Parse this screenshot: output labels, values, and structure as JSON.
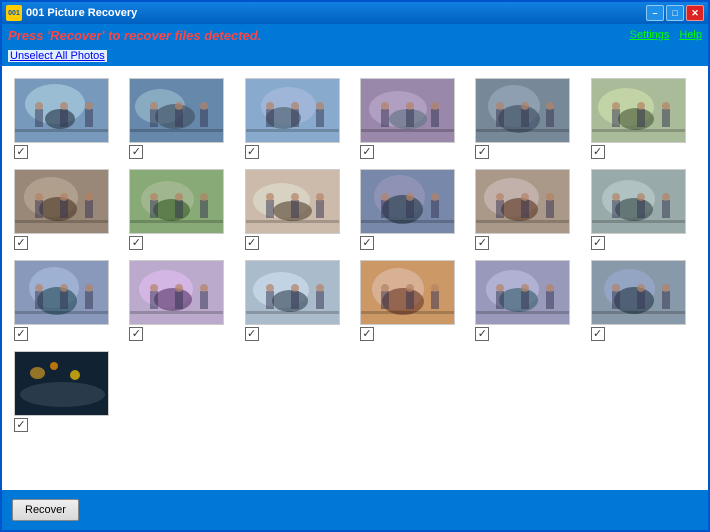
{
  "window": {
    "title": "001 Picture Recovery",
    "title_icon": "001"
  },
  "header": {
    "instruction": "Press 'Recover' to recover files detected.",
    "unselect_all": "Unselect All Photos",
    "settings_link": "Settings",
    "help_link": "Help"
  },
  "photos": {
    "count": 19,
    "all_checked": true,
    "items": [
      {
        "id": 1,
        "thumb_class": "thumb-1",
        "checked": true
      },
      {
        "id": 2,
        "thumb_class": "thumb-2",
        "checked": true
      },
      {
        "id": 3,
        "thumb_class": "thumb-3",
        "checked": true
      },
      {
        "id": 4,
        "thumb_class": "thumb-4",
        "checked": true
      },
      {
        "id": 5,
        "thumb_class": "thumb-5",
        "checked": true
      },
      {
        "id": 6,
        "thumb_class": "thumb-6",
        "checked": true
      },
      {
        "id": 7,
        "thumb_class": "thumb-7",
        "checked": true
      },
      {
        "id": 8,
        "thumb_class": "thumb-8",
        "checked": true
      },
      {
        "id": 9,
        "thumb_class": "thumb-9",
        "checked": true
      },
      {
        "id": 10,
        "thumb_class": "thumb-10",
        "checked": true
      },
      {
        "id": 11,
        "thumb_class": "thumb-11",
        "checked": true
      },
      {
        "id": 12,
        "thumb_class": "thumb-12",
        "checked": true
      },
      {
        "id": 13,
        "thumb_class": "thumb-13",
        "checked": true
      },
      {
        "id": 14,
        "thumb_class": "thumb-14",
        "checked": true
      },
      {
        "id": 15,
        "thumb_class": "thumb-15",
        "checked": true
      },
      {
        "id": 16,
        "thumb_class": "thumb-16",
        "checked": true
      },
      {
        "id": 17,
        "thumb_class": "thumb-17",
        "checked": true
      },
      {
        "id": 18,
        "thumb_class": "thumb-18",
        "checked": true
      },
      {
        "id": 19,
        "thumb_class": "thumb-19",
        "checked": true
      }
    ]
  },
  "footer": {
    "recover_button": "Recover"
  }
}
